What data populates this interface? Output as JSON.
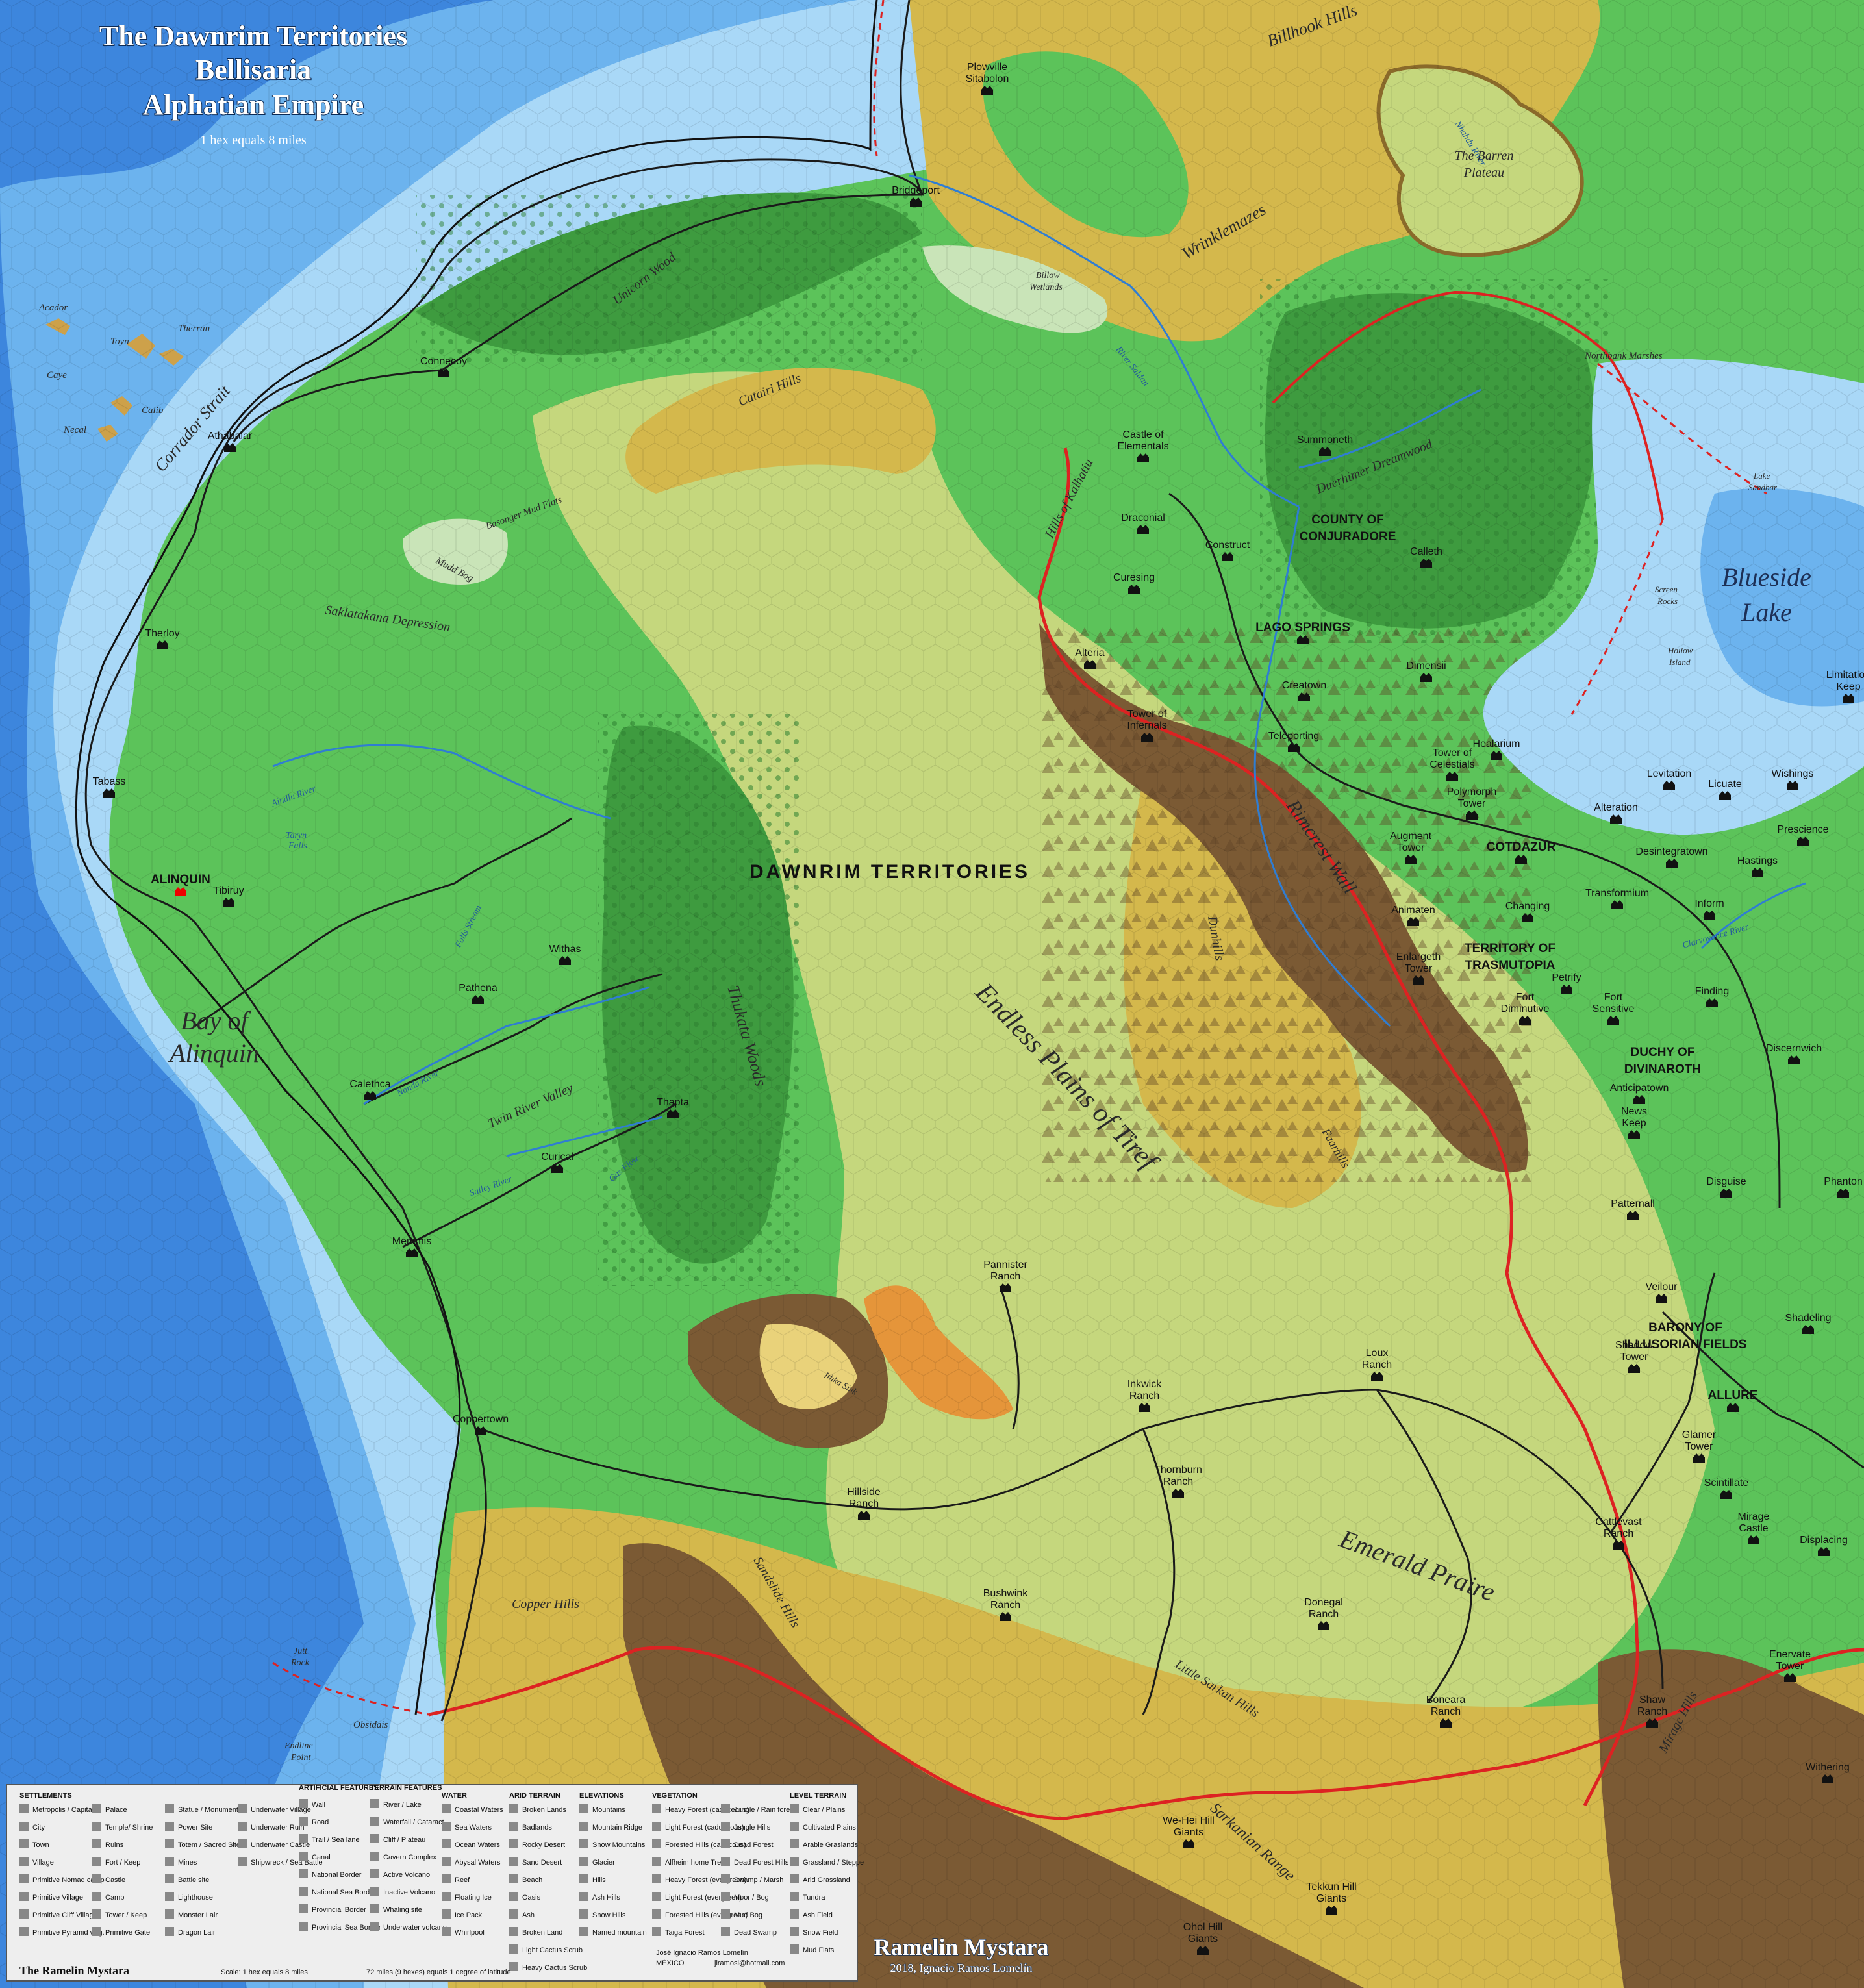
{
  "title": {
    "line1": "The Dawnrim Territories",
    "line2": "Bellisaria",
    "line3": "Alphatian Empire",
    "scale": "1 hex equals 8 miles"
  },
  "colors": {
    "deep_sea": "#3d86dd",
    "sea": "#6cb3ee",
    "shallow": "#a9d8f7",
    "grassland": "#5cc35a",
    "plains": "#c5d77d",
    "hills": "#d4b84c",
    "mountains": "#7b5a34",
    "forest": "#3e9b3f",
    "marsh": "#c9e4b8",
    "badlands": "#e5953a",
    "national_border": "#d22",
    "road": "#1a1a1a"
  },
  "regions": [
    {
      "name": "DAWNRIM TERRITORIES",
      "kind": "territory"
    },
    {
      "name": "COUNTY OF CONJURADORE",
      "kind": "dominion"
    },
    {
      "name": "TERRITORY OF TRASMUTOPIA",
      "kind": "dominion"
    },
    {
      "name": "DUCHY OF DIVINAROTH",
      "kind": "dominion"
    },
    {
      "name": "BARONY OF ILLUSORIAN FIELDS",
      "kind": "dominion"
    }
  ],
  "features": {
    "endless_plains": "Endless Plains of Tiref",
    "emerald_prairie": "Emerald Praire",
    "bay": "Bay of Alinquin",
    "blueside": "Blueside Lake",
    "corridor_strait": "Corrador Strait",
    "unicorn_wood": "Unicorn Wood",
    "catairi_hills": "Catairi Hills",
    "billhook_hills": "Billhook Hills",
    "barren_plateau": "The Barren Plateau",
    "wrinklemazes": "Wrinklemazes",
    "saklatakana": "Saklatakana Depression",
    "basonger": "Basonger Mud Flats",
    "mudd_bog": "Mudd Bog",
    "billow_wetlands": "Billow Wetlands",
    "hills_kalhatiu": "Hills of Kalhatiu",
    "twin_river_valley": "Twin River Valley",
    "thukata_woods": "Thukata Woods",
    "ithka_sink": "Ithka Sink",
    "copper_hills": "Copper Hills",
    "sandslide_hills": "Sandslide Hills",
    "little_sarkan_hills": "Little Sarkan Hills",
    "sarkanian_range": "Sarkanian Range",
    "rimcrest_wall": "Rimcrest Wall",
    "dunhills": "Dunhills",
    "faarhills": "Faarhills",
    "mirage_hills": "Mirage Hills",
    "duerhimer_dreamwood": "Duerhimer Dreamwood",
    "northbank_marshes": "Northbank Marshes",
    "lake_sandbar": "Lake Sandbar",
    "screen_rocks": "Screen Rocks",
    "hollow_island": "Hollow Island",
    "jutt_rock": "Jutt Rock",
    "obsidais": "Obsidais",
    "endline_point": "Endline Point",
    "acador": "Acador",
    "therran": "Therran",
    "toyn": "Toyn",
    "caye": "Caye",
    "calib": "Calib",
    "necal": "Necal",
    "aindlu_river": "Aindlu River",
    "taryn_falls": "Taryn Falls",
    "falls_stream": "Falls Stream",
    "nanda_river": "Nanda River",
    "salley_river": "Salley River",
    "gas_flow": "Gas Flow",
    "river_saldan": "River Saldan",
    "nhahdu_river": "Nhahdu River",
    "clarvoyance_river": "Clarvoyance River"
  },
  "settlements": [
    {
      "name": "Plowville Sitabolon"
    },
    {
      "name": "Bridgeport"
    },
    {
      "name": "Connecoy"
    },
    {
      "name": "Athabalar"
    },
    {
      "name": "Therloy"
    },
    {
      "name": "Tabass"
    },
    {
      "name": "ALINQUIN"
    },
    {
      "name": "Tibiruy"
    },
    {
      "name": "Withas"
    },
    {
      "name": "Pathena"
    },
    {
      "name": "Calethca"
    },
    {
      "name": "Thapta"
    },
    {
      "name": "Curical"
    },
    {
      "name": "Memmis"
    },
    {
      "name": "Coppertown"
    },
    {
      "name": "Castle of Elementals"
    },
    {
      "name": "Draconial"
    },
    {
      "name": "Construct"
    },
    {
      "name": "Curesing"
    },
    {
      "name": "Alteria"
    },
    {
      "name": "Summoneth"
    },
    {
      "name": "Calleth"
    },
    {
      "name": "LAGO SPRINGS"
    },
    {
      "name": "Creatown"
    },
    {
      "name": "Dimensii"
    },
    {
      "name": "Tower of Infernals"
    },
    {
      "name": "Teleporting"
    },
    {
      "name": "Healarium"
    },
    {
      "name": "Tower of Celestials"
    },
    {
      "name": "Polymorph Tower"
    },
    {
      "name": "Augment Tower"
    },
    {
      "name": "COTDAZUR"
    },
    {
      "name": "Animaten"
    },
    {
      "name": "Changing"
    },
    {
      "name": "Enlargeth Tower"
    },
    {
      "name": "Petrify"
    },
    {
      "name": "Fort Diminutive"
    },
    {
      "name": "Fort Sensitive"
    },
    {
      "name": "Alteration"
    },
    {
      "name": "Levitation"
    },
    {
      "name": "Licuate"
    },
    {
      "name": "Wishings"
    },
    {
      "name": "Limitation Keep"
    },
    {
      "name": "Prescience"
    },
    {
      "name": "Desintegratown"
    },
    {
      "name": "Transformium"
    },
    {
      "name": "Hastings"
    },
    {
      "name": "Inform"
    },
    {
      "name": "Finding"
    },
    {
      "name": "Discernwich"
    },
    {
      "name": "Anticipatown"
    },
    {
      "name": "News Keep"
    },
    {
      "name": "Disguise"
    },
    {
      "name": "Phanton"
    },
    {
      "name": "Patternall"
    },
    {
      "name": "Veilour"
    },
    {
      "name": "Shadeling"
    },
    {
      "name": "Shadow Tower"
    },
    {
      "name": "ALLURE"
    },
    {
      "name": "Glamer Tower"
    },
    {
      "name": "Scintillate"
    },
    {
      "name": "Mirage Castle"
    },
    {
      "name": "Displacing"
    },
    {
      "name": "Enervate Tower"
    },
    {
      "name": "Withering"
    },
    {
      "name": "Pannister Ranch"
    },
    {
      "name": "Inkwick Ranch"
    },
    {
      "name": "Loux Ranch"
    },
    {
      "name": "Thornburn Ranch"
    },
    {
      "name": "Hillside Ranch"
    },
    {
      "name": "Cattlevast Ranch"
    },
    {
      "name": "Bushwink Ranch"
    },
    {
      "name": "Donegal Ranch"
    },
    {
      "name": "Boneara Ranch"
    },
    {
      "name": "Shaw Ranch"
    },
    {
      "name": "We-Hei Hill Giants"
    },
    {
      "name": "Tekkun Hill Giants"
    },
    {
      "name": "Ohol Hill Giants"
    }
  ],
  "legend": {
    "headings": [
      "SETTLEMENTS",
      "ARTIFICIAL FEATURES",
      "TERRAIN FEATURES",
      "WATER",
      "ARID TERRAIN",
      "ELEVATIONS",
      "VEGETATION",
      "LEVEL TERRAIN"
    ],
    "settlements": [
      "Metropolis / Capital",
      "City",
      "Town",
      "Village",
      "Primitive Nomad camp",
      "Primitive Village",
      "Primitive Cliff Village",
      "Primitive Pyramid villg.",
      "Palace",
      "Temple/ Shrine",
      "Ruins",
      "Fort / Keep",
      "Castle",
      "Camp",
      "Tower / Keep",
      "Primitive Gate",
      "Statue / Monument",
      "Power Site",
      "Totem / Sacred Site",
      "Mines",
      "Battle site",
      "Lighthouse",
      "Monster Lair",
      "Dragon Lair",
      "Underwater Village",
      "Underwater Ruin",
      "Underwater Castle",
      "Shipwreck / Sea Battle"
    ],
    "artificial": [
      "Wall",
      "Road",
      "Trail / Sea lane",
      "Canal",
      "National Border",
      "National Sea Border",
      "Provincial Border",
      "Provincial Sea Border"
    ],
    "terrain_features": [
      "River / Lake",
      "Waterfall / Cataract",
      "Cliff / Plateau",
      "Cavern Complex",
      "Active Volcano",
      "Inactive Volcano",
      "Whaling site",
      "Underwater volcano"
    ],
    "water": [
      "Coastal Waters",
      "Sea Waters",
      "Ocean Waters",
      "Abysal Waters",
      "Reef",
      "Floating Ice",
      "Ice Pack",
      "Whirlpool"
    ],
    "arid": [
      "Broken Lands",
      "Badlands",
      "Rocky Desert",
      "Sand Desert",
      "Beach",
      "Oasis",
      "Ash",
      "Broken Land",
      "Light Cactus Scrub",
      "Heavy Cactus Scrub"
    ],
    "elevations": [
      "Mountains",
      "Mountain Ridge",
      "Snow Mountains",
      "Glacier",
      "Hills",
      "Ash Hills",
      "Snow Hills",
      "Named mountain"
    ],
    "vegetation": [
      "Heavy Forest (caduceous)",
      "Light Forest (caduceous)",
      "Forested Hills (caducous)",
      "Alfheim home Trees",
      "Heavy Forest (evergreen)",
      "Light Forest (evergreen)",
      "Forested Hills (evergreen)",
      "Taiga Forest",
      "Jungle / Rain forest",
      "Jungle Hills",
      "Dead Forest",
      "Dead Forest Hills",
      "Swamp / Marsh",
      "Moor / Bog",
      "Mud Bog",
      "Dead Swamp"
    ],
    "level": [
      "Clear / Plains",
      "Cultivated Plains",
      "Arable Graslands",
      "Grassland / Steppe",
      "Arid Grassland",
      "Tundra",
      "Ash Field",
      "Snow Field",
      "Mud Flats"
    ],
    "footer_left": "The Ramelin Mystara",
    "footer_scale": "Scale: 1 hex equals 8 miles",
    "footer_lat": "72 miles (9 hexes) equals 1 degree of latitude",
    "author": "José Ignacio Ramos Lomelín",
    "country": "MÉXICO",
    "email": "jiramosl@hotmail.com"
  },
  "credit": {
    "title": "Ramelin Mystara",
    "sub": "2018, Ignacio Ramos Lomelín"
  }
}
